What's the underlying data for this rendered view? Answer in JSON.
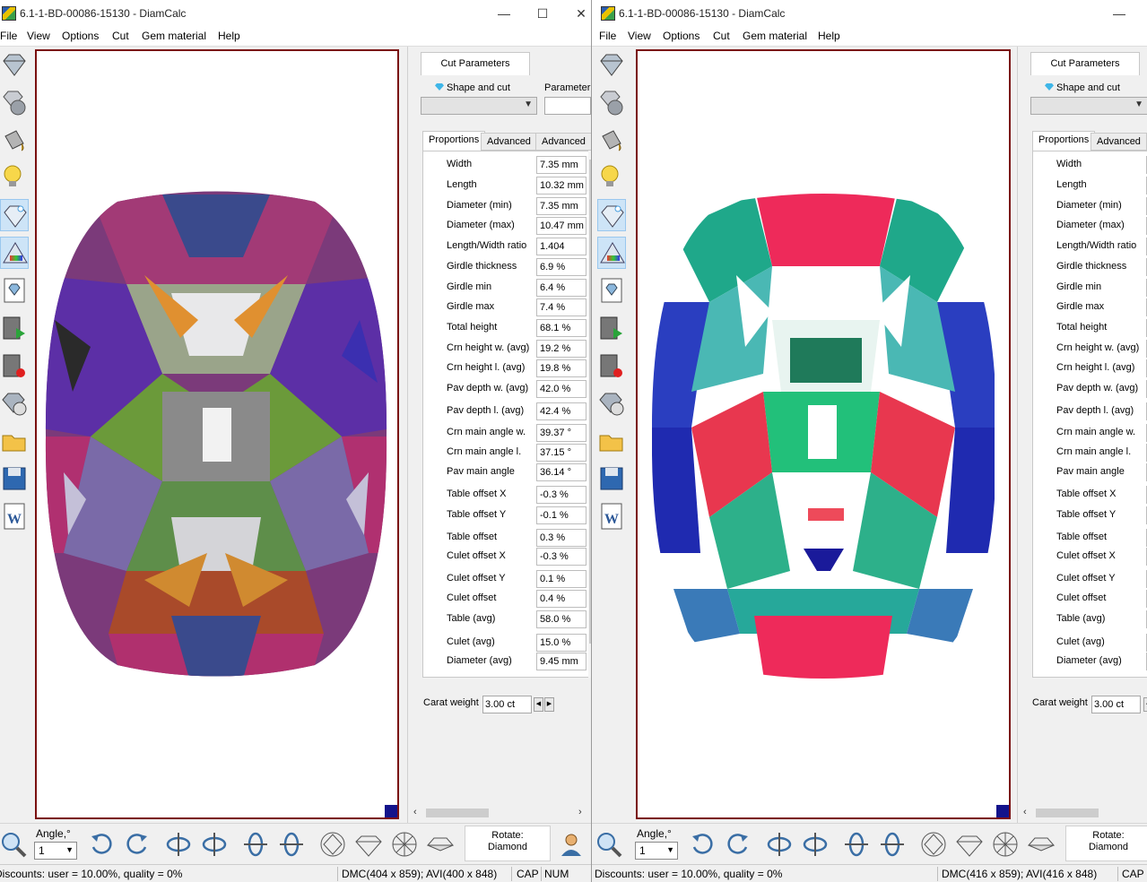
{
  "left_window": {
    "title": "6.1-1-BD-00086-15130 - DiamCalc",
    "menu": [
      "File",
      "View",
      "Options",
      "Cut",
      "Gem material",
      "Help"
    ],
    "panel": {
      "tab": "Cut Parameters",
      "shape_label": "Shape and cut",
      "parameter_label": "Parameter",
      "subtabs": [
        "Proportions",
        "Advanced",
        "Advanced"
      ],
      "rows": [
        {
          "label": "Width",
          "value": "7.35 mm"
        },
        {
          "label": "Length",
          "value": "10.32 mm"
        },
        {
          "label": "Diameter (min)",
          "value": "7.35 mm"
        },
        {
          "label": "Diameter (max)",
          "value": "10.47 mm"
        },
        {
          "label": "Length/Width ratio",
          "value": "1.404"
        },
        {
          "label": "Girdle thickness",
          "value": "6.9 %"
        },
        {
          "label": "Girdle min",
          "value": "6.4 %"
        },
        {
          "label": "Girdle max",
          "value": "7.4 %"
        },
        {
          "label": "Total height",
          "value": "68.1 %"
        },
        {
          "label": "Crn height w. (avg)",
          "value": "19.2 %"
        },
        {
          "label": "Crn height l. (avg)",
          "value": "19.8 %"
        },
        {
          "label": "Pav depth w. (avg)",
          "value": "42.0 %"
        },
        {
          "label": "Pav depth l. (avg)",
          "value": "42.4 %"
        },
        {
          "label": "Crn main angle w.",
          "value": "39.37 °"
        },
        {
          "label": "Crn main angle l.",
          "value": "37.15 °"
        },
        {
          "label": "Pav main angle",
          "value": "36.14 °"
        },
        {
          "label": "Table offset X",
          "value": "-0.3 %"
        },
        {
          "label": "Table offset Y",
          "value": "-0.1 %"
        },
        {
          "label": "Table offset",
          "value": "0.3 %"
        },
        {
          "label": "Culet offset X",
          "value": "-0.3 %"
        },
        {
          "label": "Culet offset Y",
          "value": "0.1 %"
        },
        {
          "label": "Culet offset",
          "value": "0.4 %"
        },
        {
          "label": "Table (avg)",
          "value": "58.0 %"
        },
        {
          "label": "Culet (avg)",
          "value": "15.0 %"
        },
        {
          "label": "Diameter (avg)",
          "value": "9.45 mm"
        }
      ],
      "carat_label": "Carat weight",
      "carat_value": "3.00 ct"
    },
    "bottom": {
      "angle_label": "Angle,°",
      "angle_value": "1",
      "rotate_label": "Rotate:",
      "rotate_value": "Diamond"
    },
    "status": {
      "discounts": "Discounts: user = 10.00%, quality = 0%",
      "dmc": "DMC(404 x 859); AVI(400 x 848)",
      "cap": "CAP",
      "num": "NUM"
    }
  },
  "right_window": {
    "title": "6.1-1-BD-00086-15130 - DiamCalc",
    "menu": [
      "File",
      "View",
      "Options",
      "Cut",
      "Gem material",
      "Help"
    ],
    "panel": {
      "tab": "Cut Parameters",
      "shape_label": "Shape and cut",
      "subtabs": [
        "Proportions",
        "Advanced"
      ],
      "rows": [
        {
          "label": "Width"
        },
        {
          "label": "Length"
        },
        {
          "label": "Diameter (min)"
        },
        {
          "label": "Diameter (max)"
        },
        {
          "label": "Length/Width ratio"
        },
        {
          "label": "Girdle thickness"
        },
        {
          "label": "Girdle min"
        },
        {
          "label": "Girdle max"
        },
        {
          "label": "Total height"
        },
        {
          "label": "Crn height w. (avg)"
        },
        {
          "label": "Crn height l. (avg)"
        },
        {
          "label": "Pav depth w. (avg)"
        },
        {
          "label": "Pav depth l. (avg)"
        },
        {
          "label": "Crn main angle w."
        },
        {
          "label": "Crn main angle l."
        },
        {
          "label": "Pav main angle"
        },
        {
          "label": "Table offset X"
        },
        {
          "label": "Table offset Y"
        },
        {
          "label": "Table offset"
        },
        {
          "label": "Culet offset X"
        },
        {
          "label": "Culet offset Y"
        },
        {
          "label": "Culet offset"
        },
        {
          "label": "Table (avg)"
        },
        {
          "label": "Culet (avg)"
        },
        {
          "label": "Diameter (avg)"
        }
      ],
      "carat_label": "Carat weight",
      "carat_value": "3.00 ct"
    },
    "bottom": {
      "angle_label": "Angle,°",
      "angle_value": "1",
      "rotate_label": "Rotate:",
      "rotate_value": "Diamond"
    },
    "status": {
      "discounts": "Discounts: user = 10.00%, quality = 0%",
      "dmc": "DMC(416 x 859); AVI(416 x 848)",
      "cap": "CAP"
    }
  },
  "colors": {
    "viewport_border": "#7a1010",
    "corner": "#13138b",
    "accent": "#3fb6e8"
  }
}
